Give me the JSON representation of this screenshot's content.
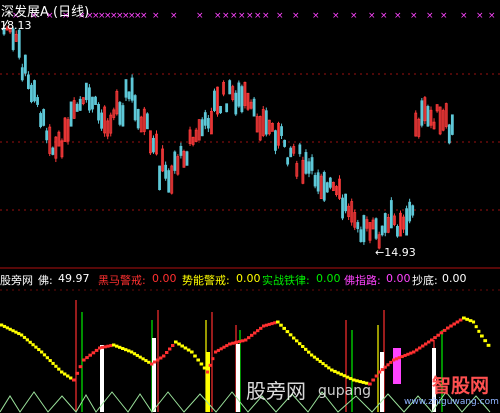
{
  "title": "深发展A (日线)",
  "price_high_label": "18.13",
  "price_low_label": "←14.93",
  "indicators": {
    "name": "股旁网",
    "fo_label": "佛:",
    "fo_value": "49.97",
    "heima_label": "黑马警戒:",
    "heima_value": "0.00",
    "shineng_label": "势能警戒:",
    "shineng_value": "0.00",
    "shizhan_label": "实战铁律:",
    "shizhan_value": "0.00",
    "fozhilu_label": "佛指路:",
    "fozhilu_value": "0.00",
    "chaodi_label": "抄底:",
    "chaodi_value": "0.00"
  },
  "watermark": {
    "left_text": "股旁网",
    "middle_text": "gupang",
    "right_text": "智股网",
    "right_sub": "www.zhiguwang.com"
  },
  "colors": {
    "background": "#000000",
    "candle_up": "#ff3b3b",
    "candle_down": "#5ec8d8",
    "marker": "#ff44ff",
    "grid": "#9a1010",
    "fo_line": "#ffff00",
    "heima": "#ff3030",
    "shineng": "#ffff00",
    "shizhan": "#00ee00",
    "fozhilu": "#ff44ff",
    "chaodi": "#ffffff"
  }
}
